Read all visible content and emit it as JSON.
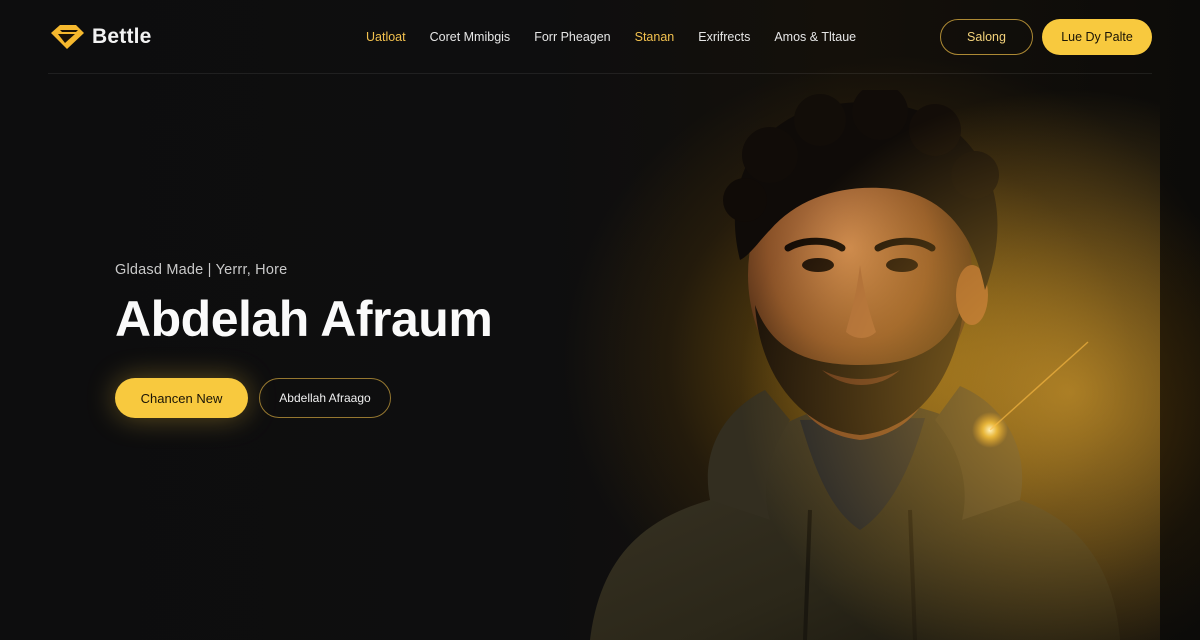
{
  "brand": {
    "name": "Bettle",
    "accent": "#f8c93e"
  },
  "nav": {
    "items": [
      {
        "label": "Uatloat",
        "accent": true
      },
      {
        "label": "Coret Mmibgis",
        "accent": false
      },
      {
        "label": "Forr Pheagen",
        "accent": false
      },
      {
        "label": "Stanan",
        "accent": true
      },
      {
        "label": "Exrifrects",
        "accent": false
      },
      {
        "label": "Amos & Tltaue",
        "accent": false
      }
    ]
  },
  "header_actions": {
    "secondary": "Salong",
    "primary": "Lue Dy Palte"
  },
  "hero": {
    "tagline": "Gldasd Made | Yerrr, Hore",
    "title": "Abdelah Afraum",
    "primary_button": "Chancen New",
    "secondary_button": "Abdellah Afraago"
  },
  "icons": {
    "logo": "diamond-logo-icon",
    "portrait": "portrait-photo"
  }
}
